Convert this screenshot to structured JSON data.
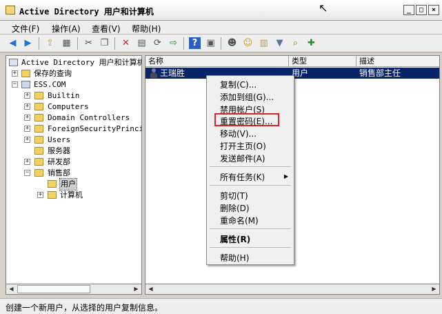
{
  "window": {
    "title": "Active Directory 用户和计算机"
  },
  "menu": [
    "文件(F)",
    "操作(A)",
    "查看(V)",
    "帮助(H)"
  ],
  "tree": {
    "root": "Active Directory 用户和计算机",
    "saved_queries": "保存的查询",
    "domain": "ESS.COM",
    "items": [
      "Builtin",
      "Computers",
      "Domain Controllers",
      "ForeignSecurityPrincip",
      "Users",
      "服务器",
      "研发部",
      "销售部",
      "用户",
      "计算机"
    ]
  },
  "list": {
    "columns": [
      "名称",
      "类型",
      "描述"
    ],
    "rows": [
      {
        "name": "王瑞胜",
        "type": "用户",
        "desc": "销售部主任"
      }
    ]
  },
  "context_menu": {
    "items": [
      "复制(C)...",
      "添加到组(G)...",
      "禁用帐户(S)",
      "重置密码(E)...",
      "移动(V)...",
      "打开主页(O)",
      "发送邮件(A)",
      "所有任务(K)",
      "剪切(T)",
      "删除(D)",
      "重命名(M)",
      "属性(R)",
      "帮助(H)"
    ],
    "highlighted": "重置密码(E)...",
    "highlight_color": "#e0202c"
  },
  "status": {
    "text": "创建一个新用户，从选择的用户复制信息。"
  },
  "colors": {
    "selection": "#0a246a",
    "folder": "#f3d260"
  }
}
